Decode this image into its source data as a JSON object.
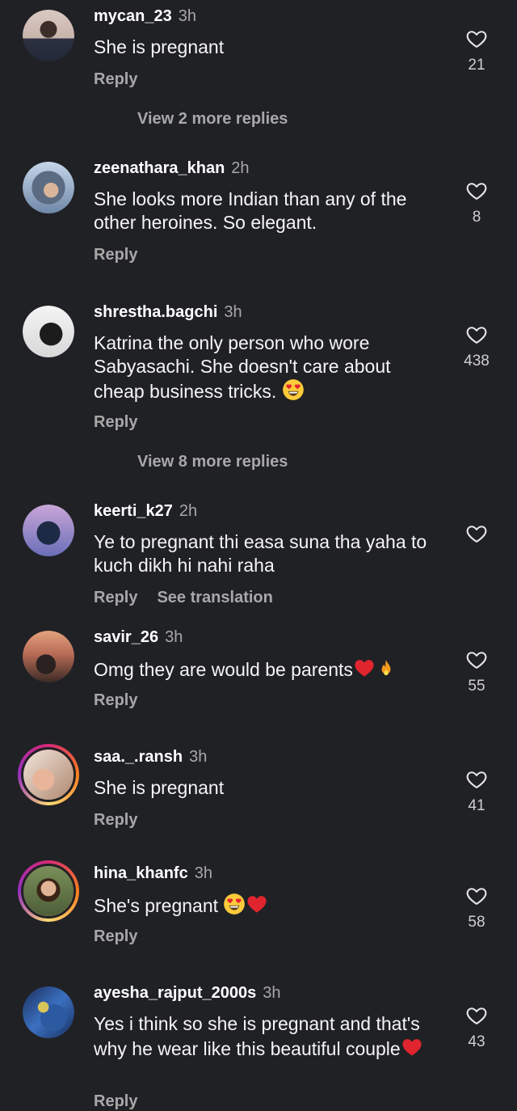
{
  "comments": [
    {
      "user": "mycan_23",
      "time": "3h",
      "text": "She is pregnant",
      "reply": "Reply",
      "likes": "21",
      "view_more": "View 2 more replies"
    },
    {
      "user": "zeenathara_khan",
      "time": "2h",
      "text": "She looks more Indian than any of the other heroines. So elegant.",
      "reply": "Reply",
      "likes": "8"
    },
    {
      "user": "shrestha.bagchi",
      "time": "3h",
      "text": "Katrina the only person who wore Sabyasachi. She doesn't care about cheap business tricks.",
      "reply": "Reply",
      "likes": "438",
      "view_more": "View 8 more replies"
    },
    {
      "user": "keerti_k27",
      "time": "2h",
      "text": "Ye to pregnant thi easa suna tha yaha to kuch dikh hi nahi raha",
      "reply": "Reply",
      "see_translation": "See translation"
    },
    {
      "user": "savir_26",
      "time": "3h",
      "text": "Omg they are would be parents",
      "reply": "Reply",
      "likes": "55"
    },
    {
      "user": "saa._.ransh",
      "time": "3h",
      "text": "She is pregnant",
      "reply": "Reply",
      "likes": "41"
    },
    {
      "user": "hina_khanfc",
      "time": "3h",
      "text": "She's pregnant",
      "reply": "Reply",
      "likes": "58"
    },
    {
      "user": "ayesha_rajput_2000s",
      "time": "3h",
      "text": "Yes i think so she is pregnant and that's why he wear like this beautiful couple",
      "reply": "Reply",
      "likes": "43"
    }
  ],
  "icons": {
    "like": "heart-outline-icon",
    "heart_eyes": "heart-eyes-emoji",
    "red_heart": "red-heart-emoji",
    "fire": "fire-emoji"
  },
  "colors": {
    "background": "#202125",
    "secondary_text": "#a8a8a8",
    "story_ring": "#d62976"
  }
}
